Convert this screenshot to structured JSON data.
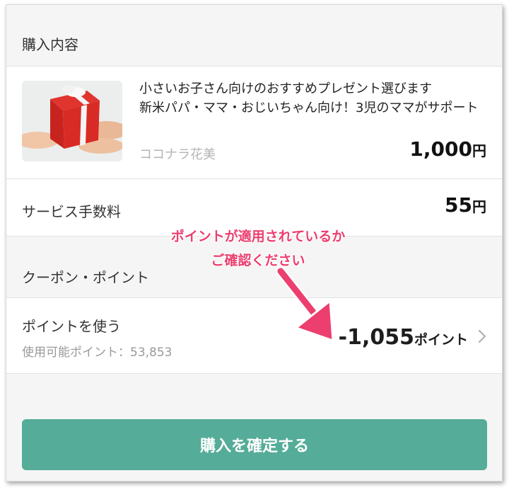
{
  "purchase_section": {
    "title": "購入内容"
  },
  "product": {
    "title_line1": "小さいお子さん向けのおすすめプレゼント選びます",
    "title_line2": "新米パパ・ママ・おじいちゃん向け！3児のママがサポート",
    "seller": "ココナラ花美",
    "price_value": "1,000",
    "price_unit": "円",
    "thumbnail_icon": "gift-box-image"
  },
  "fee": {
    "label": "サービス手数料",
    "value": "55",
    "unit": "円"
  },
  "coupon_section": {
    "title": "クーポン・ポイント"
  },
  "points": {
    "label": "ポイントを使う",
    "available_label": "使用可能ポイント：",
    "available_value": "53,853",
    "value": "-1,055",
    "unit": "ポイント"
  },
  "annotation": {
    "line1": "ポイントが適用されているか",
    "line2": "ご確認ください"
  },
  "confirm_button": {
    "label": "購入を確定する"
  },
  "colors": {
    "accent": "#55ac98",
    "annotation": "#ec3f6f"
  }
}
